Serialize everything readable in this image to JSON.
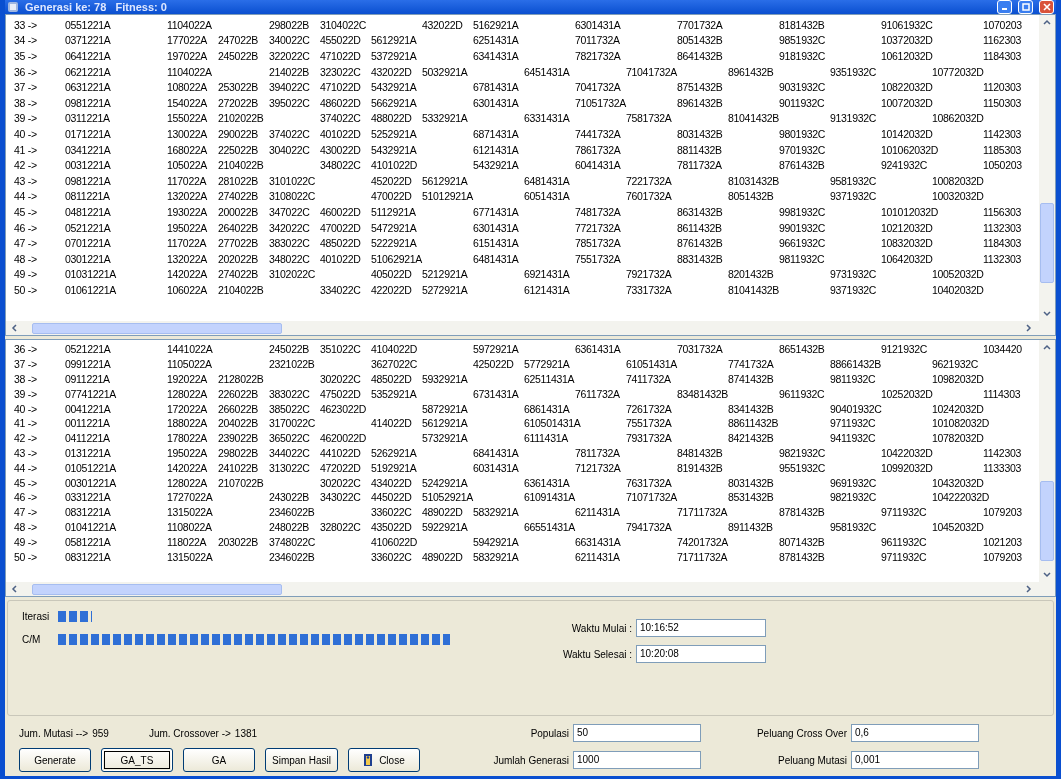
{
  "window": {
    "title": "Generasi ke: 78   Fitness: 0"
  },
  "top_list": {
    "rows": [
      "33 ->\t0551221A\t\t1104022A\t\t298022B\t3104022C\t\t432022D\t5162921A\t\t6301431A\t\t7701732A\t\t8181432B\t\t91061932C\t\t1070203",
      "34 ->\t0371221A\t\t177022A\t247022B\t340022C\t455022D\t5612921A\t\t6251431A\t\t7011732A\t\t8051432B\t\t9851932C\t\t10372032D\t\t1162303",
      "35 ->\t0641221A\t\t197022A\t245022B\t322022C\t471022D\t5372921A\t\t6341431A\t\t7821732A\t\t8641432B\t\t9181932C\t\t10612032D\t\t1184303",
      "36 ->\t0621221A\t\t1104022A\t\t214022B\t323022C\t432022D\t5032921A\t\t6451431A\t\t71041732A\t\t8961432B\t\t9351932C\t\t10772032D",
      "37 ->\t0631221A\t\t108022A\t253022B\t394022C\t471022D\t5432921A\t\t6781431A\t\t7041732A\t\t8751432B\t\t9031932C\t\t10822032D\t\t1120303",
      "38 ->\t0981221A\t\t154022A\t272022B\t395022C\t486022D\t5662921A\t\t6301431A\t\t71051732A\t\t8961432B\t\t9011932C\t\t10072032D\t\t1150303",
      "39 ->\t0311221A\t\t155022A\t2102022B\t\t374022C\t488022D\t5332921A\t\t6331431A\t\t7581732A\t\t81041432B\t\t9131932C\t\t10862032D",
      "40 ->\t0171221A\t\t130022A\t290022B\t374022C\t401022D\t5252921A\t\t6871431A\t\t7441732A\t\t8031432B\t\t9801932C\t\t10142032D\t\t1142303",
      "41 ->\t0341221A\t\t168022A\t225022B\t304022C\t430022D\t5432921A\t\t6121431A\t\t7861732A\t\t8811432B\t\t9701932C\t\t101062032D\t\t1185303",
      "42 ->\t0031221A\t\t105022A\t2104022B\t\t348022C\t4101022D\t\t5432921A\t\t6041431A\t\t7811732A\t\t8761432B\t\t9241932C\t\t1050203",
      "43 ->\t0981221A\t\t117022A\t281022B\t3101022C\t\t452022D\t5612921A\t\t6481431A\t\t7221732A\t\t81031432B\t\t9581932C\t\t10082032D",
      "44 ->\t0811221A\t\t132022A\t274022B\t3108022C\t\t470022D\t51012921A\t\t6051431A\t\t7601732A\t\t8051432B\t\t9371932C\t\t10032032D",
      "45 ->\t0481221A\t\t193022A\t200022B\t347022C\t460022D\t5112921A\t\t6771431A\t\t7481732A\t\t8631432B\t\t9981932C\t\t101012032D\t\t1156303",
      "46 ->\t0521221A\t\t195022A\t264022B\t342022C\t470022D\t5472921A\t\t6301431A\t\t7721732A\t\t8611432B\t\t9901932C\t\t10212032D\t\t1132303",
      "47 ->\t0701221A\t\t117022A\t277022B\t383022C\t485022D\t5222921A\t\t6151431A\t\t7851732A\t\t8761432B\t\t9661932C\t\t10832032D\t\t1184303",
      "48 ->\t0301221A\t\t132022A\t202022B\t348022C\t401022D\t51062921A\t\t6481431A\t\t7551732A\t\t8831432B\t\t9811932C\t\t10642032D\t\t1132303",
      "49 ->\t01031221A\t\t142022A\t274022B\t3102022C\t\t405022D\t5212921A\t\t6921431A\t\t7921732A\t\t8201432B\t\t9731932C\t\t10052032D",
      "50 ->\t01061221A\t\t106022A\t2104022B\t\t334022C\t422022D\t5272921A\t\t6121431A\t\t7331732A\t\t81041432B\t\t9371932C\t\t10402032D"
    ]
  },
  "bottom_list": {
    "rows": [
      "36 ->\t0521221A\t\t1441022A\t\t245022B\t351022C\t4104022D\t\t5972921A\t\t6361431A\t\t7031732A\t\t8651432B\t\t9121932C\t\t1034420",
      "37 ->\t0991221A\t\t1105022A\t\t2321022B\t\t3627022C\t\t425022D\t5772921A\t\t61051431A\t\t7741732A\t\t88661432B\t\t9621932C",
      "38 ->\t0911221A\t\t192022A\t2128022B\t\t302022C\t485022D\t5932921A\t\t62511431A\t\t7411732A\t\t8741432B\t\t9811932C\t\t10982032D",
      "39 ->\t07741221A\t\t128022A\t226022B\t383022C\t475022D\t5352921A\t\t6731431A\t\t7611732A\t\t83481432B\t\t9611932C\t\t10252032D\t\t1114303",
      "40 ->\t0041221A\t\t172022A\t266022B\t385022C\t4623022D\t\t5872921A\t\t6861431A\t\t7261732A\t\t8341432B\t\t90401932C\t\t10242032D",
      "41 ->\t0011221A\t\t188022A\t204022B\t3170022C\t\t414022D\t5612921A\t\t610501431A\t\t7551732A\t\t88611432B\t\t9711932C\t\t101082032D",
      "42 ->\t0411221A\t\t178022A\t239022B\t365022C\t4620022D\t\t5732921A\t\t6111431A\t\t7931732A\t\t8421432B\t\t9411932C\t\t10782032D",
      "43 ->\t0131221A\t\t195022A\t298022B\t344022C\t441022D\t5262921A\t\t6841431A\t\t7811732A\t\t8481432B\t\t9821932C\t\t10422032D\t\t1142303",
      "44 ->\t01051221A\t\t142022A\t241022B\t313022C\t472022D\t5192921A\t\t6031431A\t\t7121732A\t\t8191432B\t\t9551932C\t\t10992032D\t\t1133303",
      "45 ->\t00301221A\t\t128022A\t2107022B\t\t302022C\t434022D\t5242921A\t\t6361431A\t\t7631732A\t\t8031432B\t\t9691932C\t\t10432032D",
      "46 ->\t0331221A\t\t1727022A\t\t243022B\t343022C\t445022D\t51052921A\t\t61091431A\t\t71071732A\t\t8531432B\t\t9821932C\t\t104222032D",
      "47 ->\t0831221A\t\t1315022A\t\t2346022B\t\t336022C\t489022D\t5832921A\t\t6211431A\t\t71711732A\t\t8781432B\t\t9711932C\t\t1079203",
      "48 ->\t01041221A\t\t1108022A\t\t248022B\t328022C\t435022D\t5922921A\t\t66551431A\t\t7941732A\t\t8911432B\t\t9581932C\t\t10452032D",
      "49 ->\t0581221A\t\t118022A\t203022B\t3748022C\t\t4106022D\t\t5942921A\t\t6631431A\t\t74201732A\t\t8071432B\t\t9611932C\t\t1021203",
      "50 ->\t0831221A\t\t1315022A\t\t2346022B\t\t336022C\t489022D\t5832921A\t\t6211431A\t\t71711732A\t\t8781432B\t\t9711932C\t\t1079203"
    ]
  },
  "progress": {
    "bars": [
      {
        "label": "Iterasi"
      },
      {
        "label": "C/M"
      }
    ],
    "fields": [
      {
        "label": "Waktu Mulai :",
        "value": "10:16:52"
      },
      {
        "label": "Waktu Selesai :",
        "value": "10:20:08"
      }
    ]
  },
  "stats": [
    {
      "label": "Jum. Mutasi -->",
      "value": "959"
    },
    {
      "label": "Jum. Crossover ->",
      "value": "1381"
    }
  ],
  "params": [
    {
      "label": "Populasi",
      "value": "50"
    },
    {
      "label": "Peluang Cross Over",
      "value": "0,6"
    },
    {
      "label": "Jumlah Generasi",
      "value": "1000"
    },
    {
      "label": "Peluang Mutasi",
      "value": "0,001"
    }
  ],
  "buttons": [
    {
      "label": "Generate",
      "kind": "text",
      "focused": false
    },
    {
      "label": "GA_TS",
      "kind": "text",
      "focused": true
    },
    {
      "label": "GA",
      "kind": "text",
      "focused": false
    },
    {
      "label": "Simpan Hasil",
      "kind": "text",
      "focused": false
    },
    {
      "label": "Close",
      "kind": "icon",
      "focused": false
    }
  ]
}
